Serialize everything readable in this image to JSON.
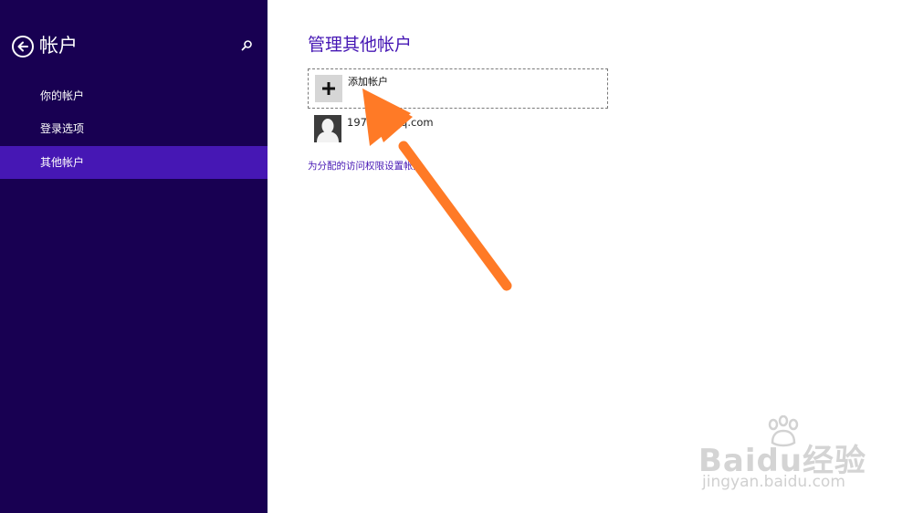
{
  "sidebar": {
    "title": "帐户",
    "items": [
      {
        "label": "你的帐户"
      },
      {
        "label": "登录选项"
      },
      {
        "label": "其他帐户",
        "active": true
      }
    ]
  },
  "main": {
    "title": "管理其他帐户",
    "add_account_label": "添加帐户",
    "user_email": "197 28@qq.com",
    "access_link": "为分配的访问权限设置帐户"
  },
  "watermark": {
    "brand": "Baidu经验",
    "url": "jingyan.baidu.com"
  },
  "colors": {
    "sidebar_bg": "#180052",
    "accent": "#4617b4",
    "arrow": "#ff7a26"
  },
  "icons": [
    "back-arrow-icon",
    "search-icon",
    "plus-icon",
    "user-avatar-icon"
  ]
}
